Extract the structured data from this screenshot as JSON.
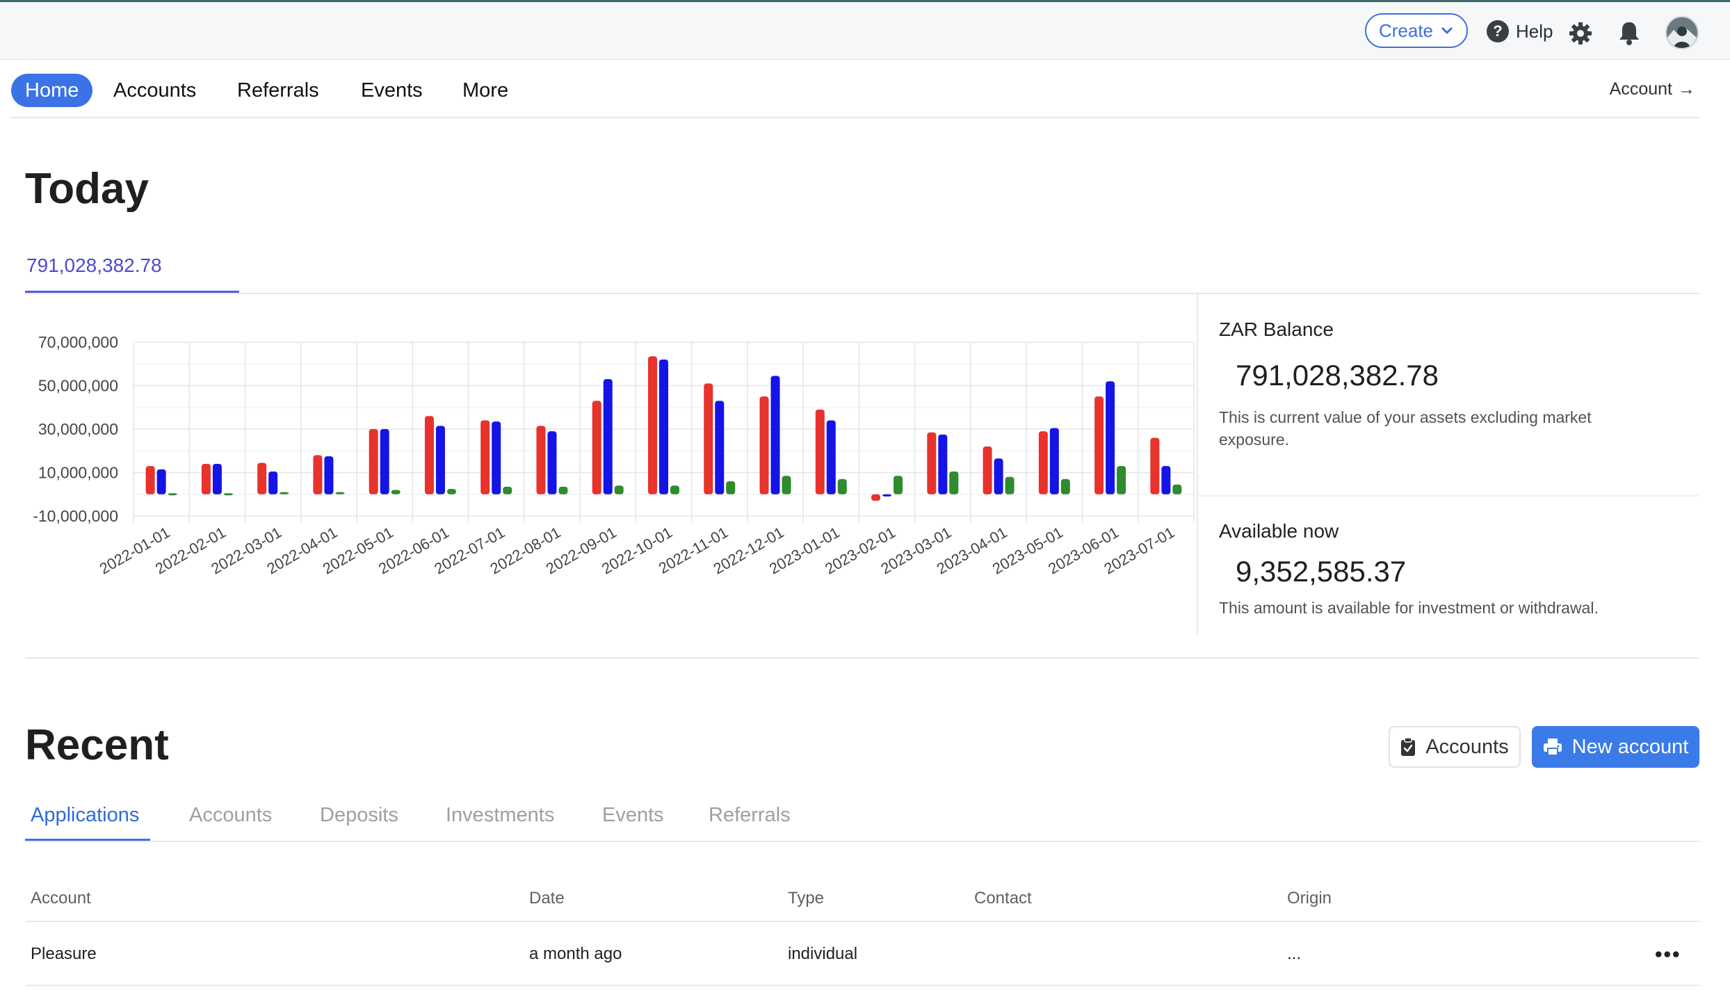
{
  "topbar": {
    "create_label": "Create",
    "help_label": "Help",
    "icons": [
      "chevron-down-icon",
      "help-icon",
      "gear-icon",
      "bell-icon",
      "avatar"
    ]
  },
  "nav": {
    "items": [
      "Home",
      "Accounts",
      "Referrals",
      "Events",
      "More"
    ],
    "account_link": "Account",
    "account_arrow": "→"
  },
  "today": {
    "title": "Today",
    "tab_value": "791,028,382.78"
  },
  "stats": {
    "balance_title": "ZAR Balance",
    "balance_value": "791,028,382.78",
    "balance_desc": "This is current value of your assets excluding market exposure.",
    "available_title": "Available now",
    "available_value": "9,352,585.37",
    "available_desc": "This amount is available for investment or withdrawal."
  },
  "chart_data": {
    "type": "bar",
    "categories": [
      "2022-01-01",
      "2022-02-01",
      "2022-03-01",
      "2022-04-01",
      "2022-05-01",
      "2022-06-01",
      "2022-07-01",
      "2022-08-01",
      "2022-09-01",
      "2022-10-01",
      "2022-11-01",
      "2022-12-01",
      "2023-01-01",
      "2023-02-01",
      "2023-03-01",
      "2023-04-01",
      "2023-05-01",
      "2023-06-01",
      "2023-07-01"
    ],
    "series": [
      {
        "color": "#e8322c",
        "values": [
          13000000,
          14000000,
          14500000,
          18000000,
          30000000,
          36000000,
          34000000,
          31500000,
          43000000,
          63500000,
          51000000,
          45000000,
          39000000,
          -3000000,
          28500000,
          22000000,
          29000000,
          45000000,
          26000000
        ]
      },
      {
        "color": "#1414e6",
        "values": [
          11500000,
          14000000,
          10500000,
          17500000,
          30000000,
          31500000,
          33500000,
          29000000,
          53000000,
          62000000,
          43000000,
          54500000,
          34000000,
          -1000000,
          27500000,
          16500000,
          30500000,
          52000000,
          13000000
        ]
      },
      {
        "color": "#2e8b2e",
        "values": [
          500000,
          500000,
          1000000,
          1000000,
          2000000,
          2500000,
          3500000,
          3500000,
          4000000,
          4000000,
          6000000,
          8500000,
          7000000,
          8500000,
          10500000,
          8000000,
          7000000,
          13000000,
          4500000
        ]
      }
    ],
    "ylim": [
      -10000000,
      70000000
    ],
    "yticks": [
      "70,000,000",
      "50,000,000",
      "30,000,000",
      "10,000,000",
      "-10,000,000"
    ],
    "ytick_values": [
      70000000,
      50000000,
      30000000,
      10000000,
      -10000000
    ],
    "grid": true
  },
  "recent": {
    "title": "Recent",
    "accounts_button": "Accounts",
    "new_account_button": "New account",
    "tabs": [
      "Applications",
      "Accounts",
      "Deposits",
      "Investments",
      "Events",
      "Referrals"
    ],
    "columns": [
      "Account",
      "Date",
      "Type",
      "Contact",
      "Origin"
    ],
    "rows": [
      {
        "account": "Pleasure",
        "date": "a month ago",
        "type": "individual",
        "contact": "",
        "origin": "...",
        "more": "•••"
      }
    ]
  }
}
